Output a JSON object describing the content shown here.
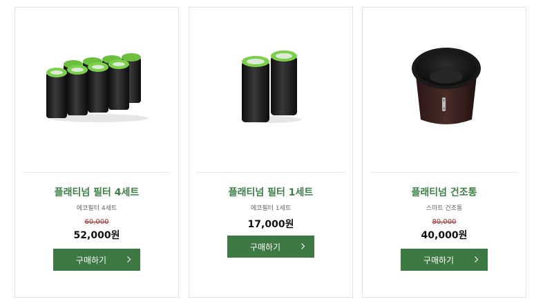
{
  "products": [
    {
      "title": "플래티넘 필터 4세트",
      "subtitle": "에코필터 4세트",
      "original_price": "60,000",
      "price": "52,000원",
      "button": "구매하기"
    },
    {
      "title": "플래티넘 필터 1세트",
      "subtitle": "에코필터 1세트",
      "original_price": "",
      "price": "17,000원",
      "button": "구매하기"
    },
    {
      "title": "플래티넘 건조통",
      "subtitle": "스마트 건조통",
      "original_price": "80,000",
      "price": "40,000원",
      "button": "구매하기"
    }
  ],
  "colors": {
    "accent": "#3d7a43",
    "title": "#3c7f44",
    "strike": "#b52a2a"
  },
  "icons": [
    "chevron-right-icon"
  ]
}
